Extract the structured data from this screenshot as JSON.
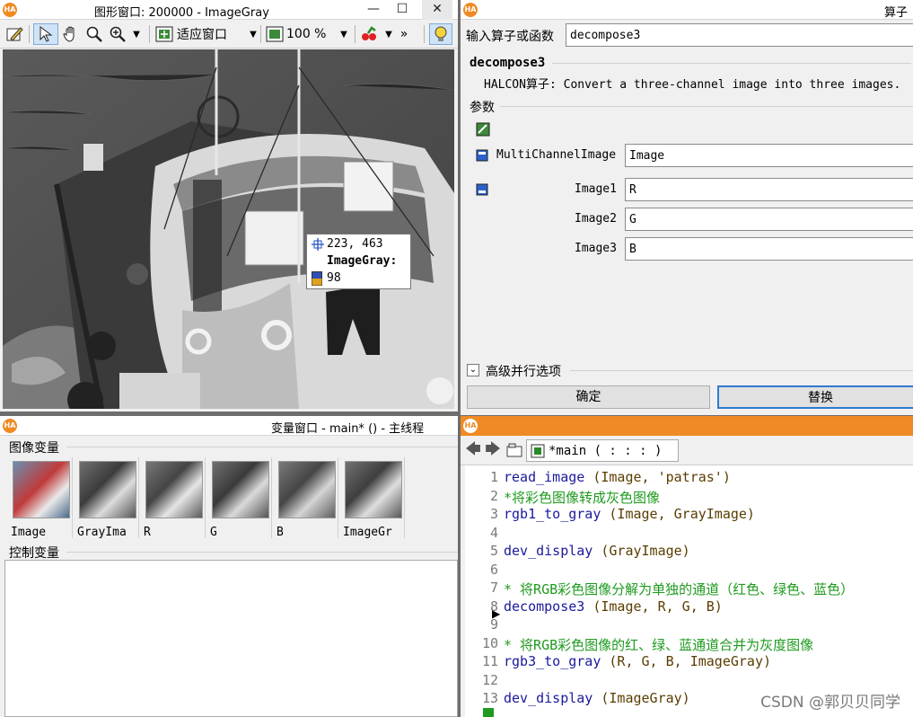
{
  "graphics_window": {
    "title": "图形窗口: 200000 - ImageGray",
    "fit_window_label": "适应窗口",
    "zoom_label": "100 %",
    "more_label": "»",
    "tooltip": {
      "coords": "223, 463",
      "name": "ImageGray:",
      "value": "98"
    }
  },
  "operator_window": {
    "title": "算子",
    "input_label": "输入算子或函数",
    "input_value": "decompose3",
    "op_name": "decompose3",
    "op_desc": "HALCON算子: Convert a three-channel image into three images.",
    "params_label": "参数",
    "params": [
      {
        "label": "MultiChannelImage",
        "value": "Image"
      },
      {
        "label": "Image1",
        "value": "R"
      },
      {
        "label": "Image2",
        "value": "G"
      },
      {
        "label": "Image3",
        "value": "B"
      }
    ],
    "advanced_label": "高级并行选项",
    "ok_label": "确定",
    "replace_label": "替换"
  },
  "variable_window": {
    "title": "变量窗口 - main* () - 主线程",
    "image_vars_label": "图像变量",
    "control_vars_label": "控制变量",
    "image_vars": [
      {
        "name": "Image"
      },
      {
        "name": "GrayIma"
      },
      {
        "name": "R"
      },
      {
        "name": "G"
      },
      {
        "name": "B"
      },
      {
        "name": "ImageGr"
      }
    ]
  },
  "program_window": {
    "tab_label": "*main ( : : : )",
    "lines": [
      {
        "n": "1",
        "parts": [
          {
            "t": "read_image",
            "c": "op"
          },
          {
            "t": " (Image, 'patras')",
            "c": "par"
          }
        ]
      },
      {
        "n": "2",
        "parts": [
          {
            "t": "*将彩色图像转成灰色图像",
            "c": "cmt"
          }
        ]
      },
      {
        "n": "3",
        "parts": [
          {
            "t": "rgb1_to_gray",
            "c": "op"
          },
          {
            "t": " (Image, GrayImage)",
            "c": "par"
          }
        ]
      },
      {
        "n": "4",
        "parts": []
      },
      {
        "n": "5",
        "parts": [
          {
            "t": "dev_display",
            "c": "op"
          },
          {
            "t": " (GrayImage)",
            "c": "par"
          }
        ]
      },
      {
        "n": "6",
        "parts": []
      },
      {
        "n": "7",
        "parts": [
          {
            "t": "* 将RGB彩色图像分解为单独的通道（红色、绿色、蓝色）",
            "c": "cmt"
          }
        ]
      },
      {
        "n": "8",
        "parts": [
          {
            "t": "decompose3",
            "c": "op"
          },
          {
            "t": " (Image, R, G, B)",
            "c": "par"
          }
        ]
      },
      {
        "n": "9",
        "parts": []
      },
      {
        "n": "10",
        "parts": [
          {
            "t": "* 将RGB彩色图像的红、绿、蓝通道合并为灰度图像",
            "c": "cmt"
          }
        ]
      },
      {
        "n": "11",
        "parts": [
          {
            "t": "rgb3_to_gray",
            "c": "op"
          },
          {
            "t": " (R, G, B, ImageGray)",
            "c": "par"
          }
        ]
      },
      {
        "n": "12",
        "parts": []
      },
      {
        "n": "13",
        "parts": [
          {
            "t": "dev_display",
            "c": "op"
          },
          {
            "t": " (ImageGray)",
            "c": "par"
          }
        ]
      }
    ]
  },
  "watermark": "CSDN @郭贝贝同学",
  "colors": {
    "accent": "#f08a24",
    "operator": "#1a1a9c",
    "comment": "#1f9a1f",
    "param": "#5a3d00"
  }
}
